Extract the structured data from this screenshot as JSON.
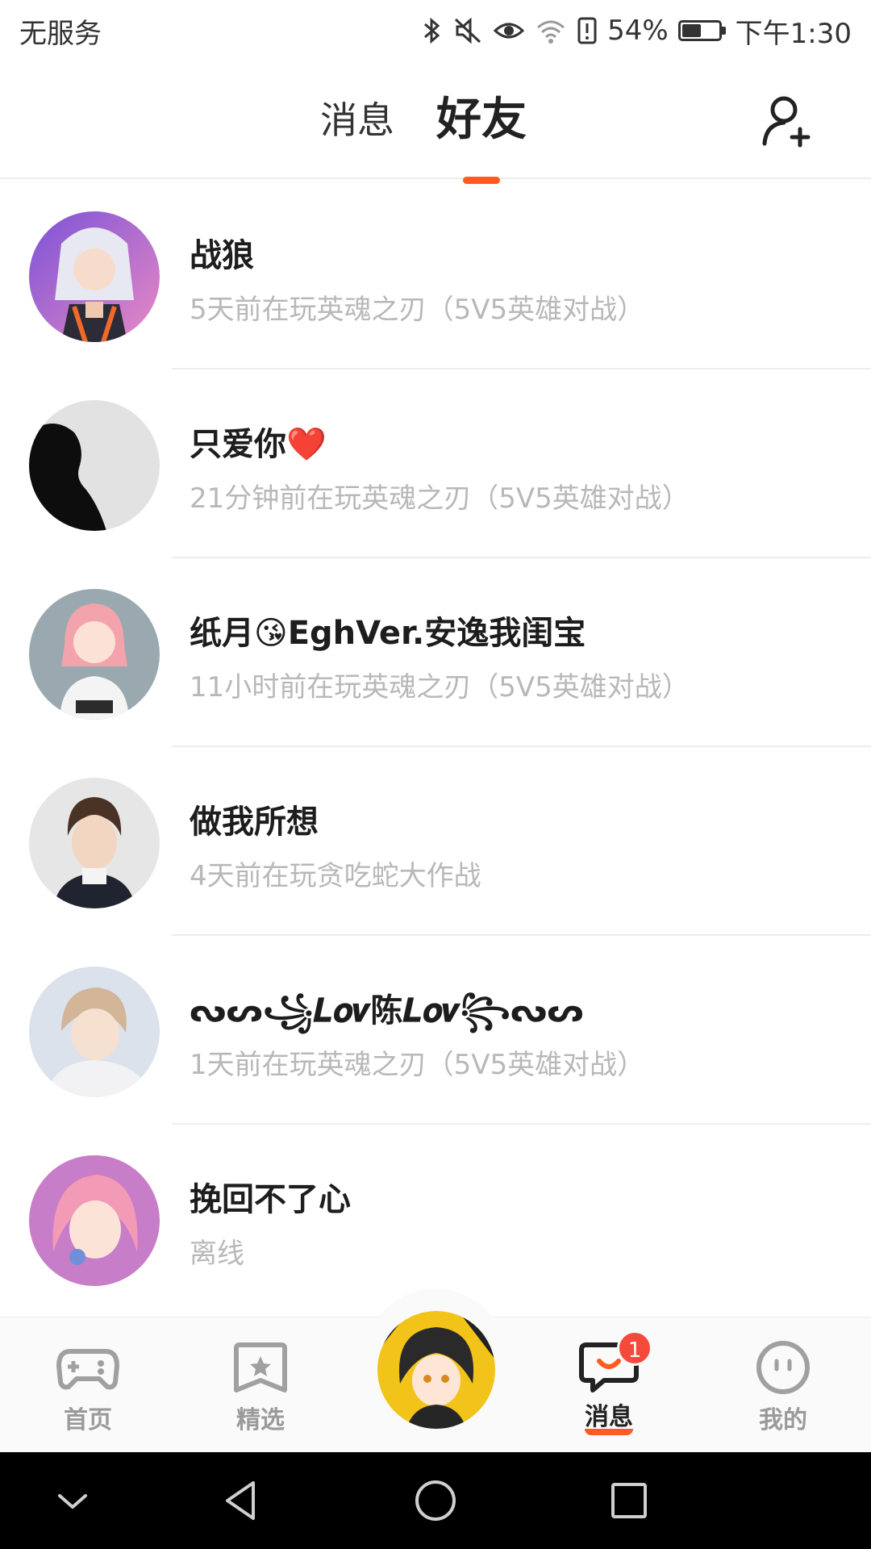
{
  "status_bar": {
    "carrier": "无服务",
    "battery_percent": "54%",
    "battery_level": 0.54,
    "time": "下午1:30"
  },
  "header": {
    "tabs": [
      {
        "label": "消息",
        "active": false
      },
      {
        "label": "好友",
        "active": true
      }
    ],
    "add_friend_icon": "person-add-icon"
  },
  "friends": [
    {
      "name": "战狼",
      "status": "5天前在玩英魂之刃（5V5英雄对战）",
      "avatar_icon": "anime-girl-avatar"
    },
    {
      "name": "只爱你❤️",
      "status": "21分钟前在玩英魂之刃（5V5英雄对战）",
      "avatar_icon": "silhouette-avatar"
    },
    {
      "name": "纸月😘EghVer.安逸我闺宝",
      "status": "11小时前在玩英魂之刃（5V5英雄对战）",
      "avatar_icon": "pink-hair-girl-avatar"
    },
    {
      "name": "做我所想",
      "status": "4天前在玩贪吃蛇大作战",
      "avatar_icon": "brown-hair-boy-avatar"
    },
    {
      "name": "ᔓᔕ꧁𝑳𝒐𝒗陈𝑳𝒐𝒗꧂ᔓᔕ",
      "status": "1天前在玩英魂之刃（5V5英雄对战）",
      "avatar_icon": "blond-boy-avatar"
    },
    {
      "name": "挽回不了心",
      "status": "离线",
      "avatar_icon": "pink-girl-avatar"
    }
  ],
  "bottom_nav": {
    "items": [
      {
        "label": "首页",
        "icon": "gamepad-icon",
        "active": false
      },
      {
        "label": "精选",
        "icon": "star-bookmark-icon",
        "active": false
      },
      {
        "label": "消息",
        "icon": "chat-bubble-icon",
        "active": true,
        "badge": "1"
      },
      {
        "label": "我的",
        "icon": "smiley-face-icon",
        "active": false
      }
    ],
    "center_avatar": "game-character-avatar"
  },
  "colors": {
    "accent": "#ff5a1f",
    "badge": "#f5493b",
    "secondary_text": "#b8b8b8"
  }
}
